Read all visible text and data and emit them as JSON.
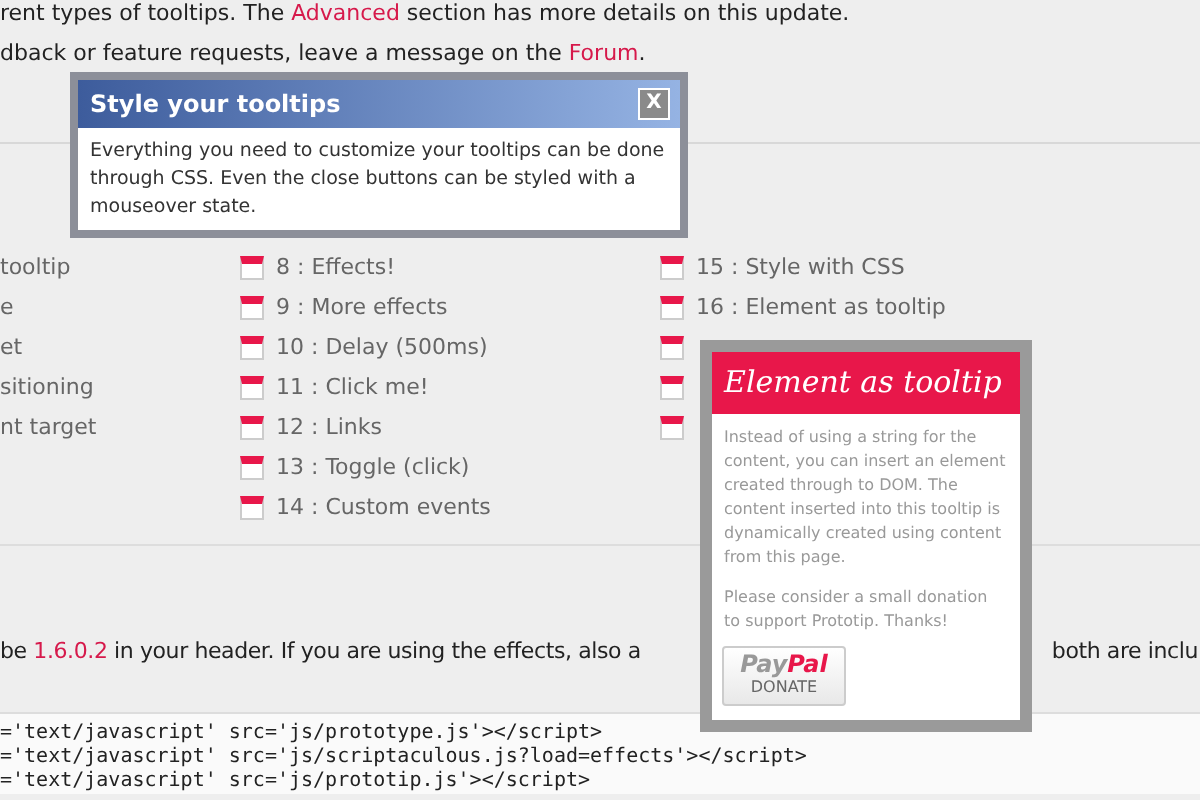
{
  "intro": [
    {
      "segments": [
        {
          "text": "rent types of tooltips. The ",
          "link": false
        },
        {
          "text": "Advanced",
          "link": true
        },
        {
          "text": " section has more details on this update.",
          "link": false
        }
      ]
    },
    {
      "segments": [
        {
          "text": "dback or feature requests, leave a message on the ",
          "link": false
        },
        {
          "text": "Forum",
          "link": true
        },
        {
          "text": ".",
          "link": false
        }
      ]
    }
  ],
  "examples": [
    [
      {
        "label": "tooltip"
      },
      {
        "label": "e"
      },
      {
        "label": "et"
      },
      {
        "label": "sitioning"
      },
      {
        "label": "nt target"
      }
    ],
    [
      {
        "label": "8 : Effects!",
        "icon": true
      },
      {
        "label": "9 : More effects",
        "icon": true
      },
      {
        "label": "10 : Delay (500ms)",
        "icon": true
      },
      {
        "label": "11 : Click me!",
        "icon": true
      },
      {
        "label": "12 : Links",
        "icon": true
      },
      {
        "label": "13 : Toggle (click)",
        "icon": true
      },
      {
        "label": "14 : Custom events",
        "icon": true
      }
    ],
    [
      {
        "label": "15 : Style with CSS",
        "icon": true
      },
      {
        "label": "16 : Element as tooltip",
        "icon": true
      },
      {
        "icon": true
      },
      {
        "icon": true
      },
      {
        "icon": true
      }
    ]
  ],
  "install_text": {
    "left": [
      {
        "text": "be ",
        "link": false
      },
      {
        "text": "1.6.0.2",
        "link": true
      },
      {
        "text": " in your header. If you are using the effects, also a",
        "link": false
      }
    ],
    "right": "both are inclu"
  },
  "code_lines": [
    "='text/javascript' src='js/prototype.js'></script>",
    "='text/javascript' src='js/scriptaculous.js?load=effects'></script>",
    "='text/javascript' src='js/prototip.js'></script>"
  ],
  "css_tooltip": {
    "title": "Style your tooltips",
    "close": "X",
    "body": "Everything you need to customize your tooltips can be done through CSS. Even the close buttons can be styled with a mouseover state."
  },
  "element_tooltip": {
    "title": "Element as tooltip",
    "paragraphs": [
      "Instead of using a string for the content, you can insert an element created through to DOM. The content inserted into this tooltip is dynamically created using content from this page.",
      "Please consider a small donation to support Prototip. Thanks!"
    ],
    "donate": {
      "brand_a": "Pay",
      "brand_b": "Pal",
      "label": "DONATE"
    }
  }
}
